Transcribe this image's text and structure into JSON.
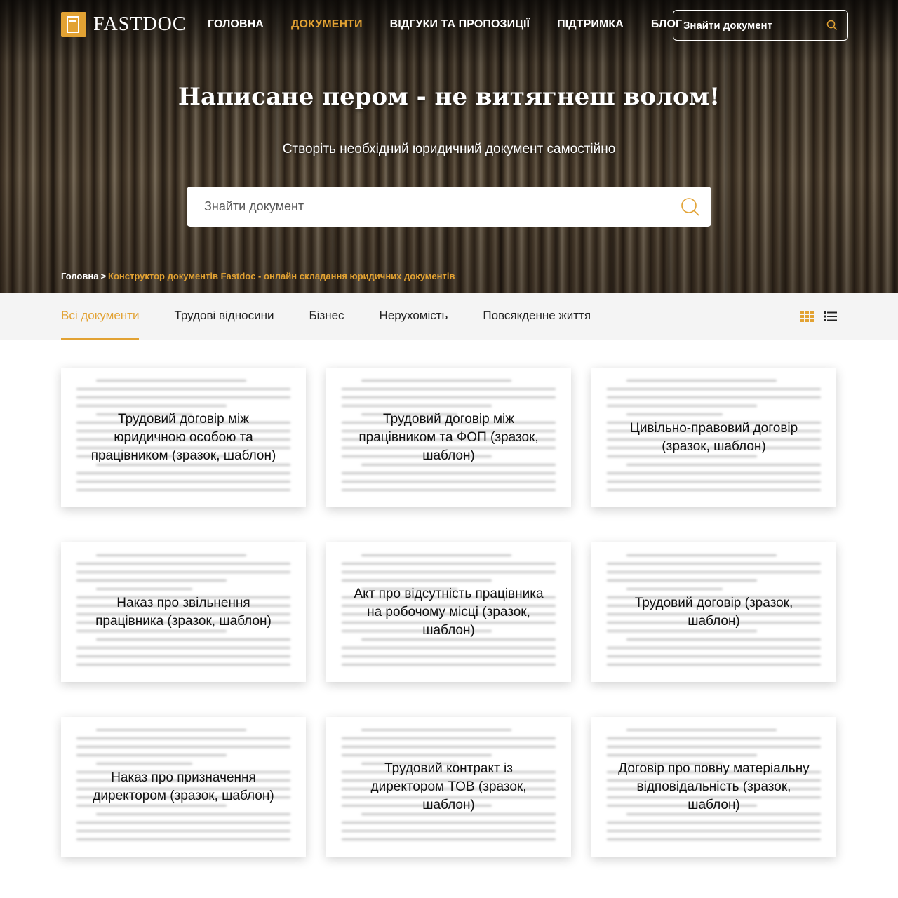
{
  "header": {
    "logo_text": "FASTDOC",
    "nav": [
      {
        "label": "ГОЛОВНА",
        "active": false
      },
      {
        "label": "ДОКУМЕНТИ",
        "active": true
      },
      {
        "label": "ВІДГУКИ ТА ПРОПОЗИЦІЇ",
        "active": false
      },
      {
        "label": "ПІДТРИМКА",
        "active": false
      },
      {
        "label": "БЛОГ",
        "active": false
      }
    ],
    "search_placeholder": "Знайти документ"
  },
  "hero": {
    "title": "Написане пером - не витягнеш волом!",
    "subtitle": "Створіть необхідний юридичний документ самостійно",
    "search_placeholder": "Знайти документ"
  },
  "breadcrumb": {
    "home": "Головна",
    "separator": ">",
    "current": "Конструктор документів Fastdoc - онлайн складання юридичних документів"
  },
  "filters": {
    "tabs": [
      {
        "label": "Всі документи",
        "active": true
      },
      {
        "label": "Трудові відносини",
        "active": false
      },
      {
        "label": "Бізнес",
        "active": false
      },
      {
        "label": "Нерухомість",
        "active": false
      },
      {
        "label": "Повсякденне життя",
        "active": false
      }
    ],
    "view_modes": [
      "grid-view-icon",
      "list-view-icon"
    ]
  },
  "documents": [
    {
      "title": "Трудовий договір між юридичною особою та працівником (зразок, шаблон)"
    },
    {
      "title": "Трудовий договір між працівником та ФОП (зразок, шаблон)"
    },
    {
      "title": "Цивільно-правовий договір (зразок, шаблон)"
    },
    {
      "title": "Наказ про звільнення працівника (зразок, шаблон)"
    },
    {
      "title": "Акт про відсутність працівника на робочому місці (зразок, шаблон)"
    },
    {
      "title": "Трудовий договір (зразок, шаблон)"
    },
    {
      "title": "Наказ про призначення директором (зразок, шаблон)"
    },
    {
      "title": "Трудовий контракт із директором ТОВ (зразок, шаблон)"
    },
    {
      "title": "Договір про повну матеріальну відповідальність (зразок, шаблон)"
    }
  ],
  "colors": {
    "accent": "#e2a233",
    "filter_bar": "#f4f4f4",
    "text": "#222222"
  }
}
